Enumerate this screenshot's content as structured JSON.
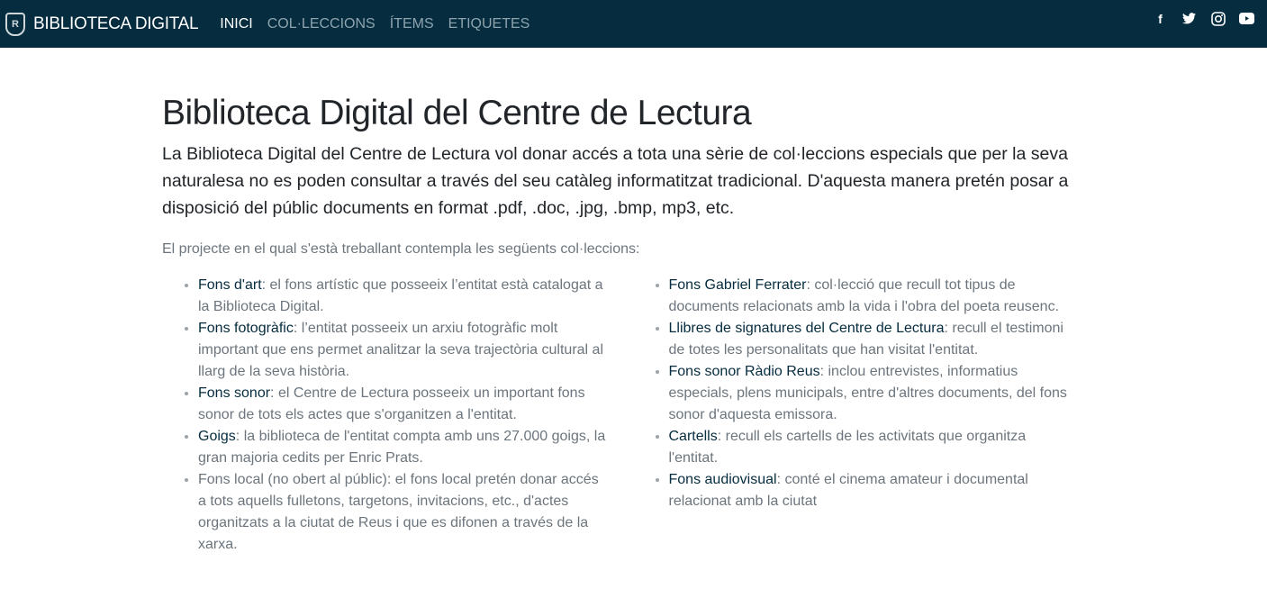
{
  "nav": {
    "brand": "BIBLIOTECA DIGITAL",
    "items": [
      "INICI",
      "COL·LECCIONS",
      "ÍTEMS",
      "ETIQUETES"
    ],
    "active": "INICI",
    "social": [
      "facebook-icon",
      "twitter-icon",
      "instagram-icon",
      "youtube-icon"
    ],
    "bg": "#052c3f"
  },
  "main": {
    "title": "Biblioteca Digital del Centre de Lectura",
    "lead": "La Biblioteca Digital del Centre de Lectura vol donar accés a tota una sèrie de col·leccions especials que per la seva naturalesa no es poden consultar a través del seu catàleg informatitzat tradicional. D'aquesta manera pretén posar a disposició del públic documents en format .pdf, .doc, .jpg, .bmp, mp3, etc.",
    "intro": "El projecte en el qual s'està treballant contempla les següents col·leccions:",
    "left": [
      {
        "link": "Fons d'art",
        "text": ": el fons artístic que posseeix l’entitat està catalogat a la Biblioteca Digital."
      },
      {
        "link": "Fons fotogràfic",
        "text": ": l’entitat posseeix un arxiu fotogràfic molt important que ens permet analitzar la seva trajectòria cultural al llarg de la seva història."
      },
      {
        "link": "Fons sonor",
        "text": ": el Centre de Lectura posseeix un important fons sonor de tots els actes que s'organitzen a l'entitat."
      },
      {
        "link": "Goigs",
        "text": ": la biblioteca de l'entitat compta amb uns 27.000 goigs, la gran majoria cedits per Enric Prats."
      },
      {
        "link": "",
        "text": "Fons local (no obert al públic): el fons local pretén donar accés a tots aquells fulletons, targetons, invitacions, etc., d'actes organitzats a la ciutat de Reus i que es difonen a través de la xarxa."
      }
    ],
    "right": [
      {
        "link": "Fons Gabriel Ferrater",
        "text": ": col·lecció que recull tot tipus de documents relacionats amb la vida i l'obra del poeta reusenc."
      },
      {
        "link": "Llibres de signatures del Centre de Lectura",
        "text": ": recull el testimoni de totes les personalitats que han visitat l'entitat."
      },
      {
        "link": "Fons sonor Ràdio Reus",
        "text": ": inclou entrevistes, informatius especials, plens municipals, entre d'altres documents, del fons sonor d'aquesta emissora."
      },
      {
        "link": "Cartells",
        "text": ": recull els cartells de les activitats que organitza l'entitat."
      },
      {
        "link": "Fons audiovisual",
        "text": ": conté el cinema amateur i documental relacionat amb la ciutat"
      }
    ]
  }
}
